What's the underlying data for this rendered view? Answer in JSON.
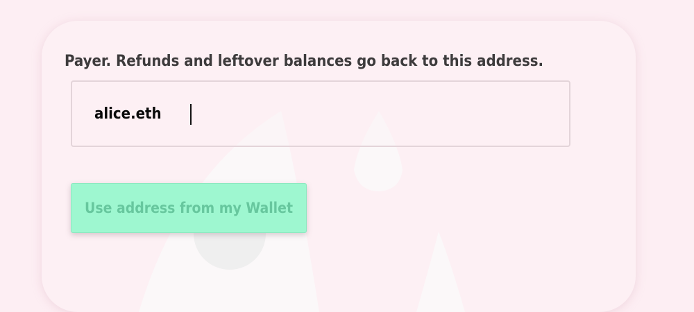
{
  "payer_form": {
    "label": "Payer. Refunds and leftover balances go back to this address.",
    "address_value": "alice.eth",
    "wallet_button_label": "Use address from my Wallet"
  },
  "colors": {
    "page_background": "#fdeef3",
    "card_background": "#fdf0f4",
    "button_background": "#9ef7d0",
    "button_text": "#67c79e",
    "label_text": "#3d3b3c",
    "input_border": "#e3d4d9"
  }
}
